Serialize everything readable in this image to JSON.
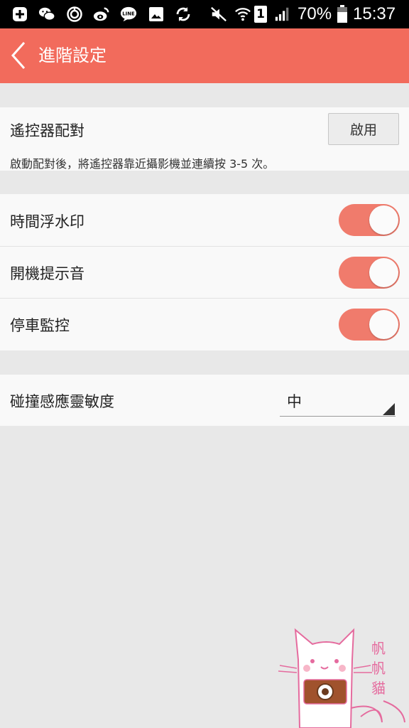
{
  "status_bar": {
    "battery_percent": "70%",
    "time": "15:37",
    "sim_label": "1",
    "icons": [
      "add-box-icon",
      "wechat-icon",
      "timer-icon",
      "weibo-icon",
      "line-icon",
      "image-icon",
      "sync-icon",
      "mute-icon",
      "wifi-icon",
      "sim-icon",
      "signal-icon",
      "battery-icon"
    ],
    "line_text": "LINE"
  },
  "app_bar": {
    "title": "進階設定",
    "background": "#f26b5c"
  },
  "remote_pairing": {
    "label": "遙控器配對",
    "button_label": "啟用",
    "hint": "啟動配對後，將遙控器靠近攝影機並連續按 3-5 次。"
  },
  "toggles": [
    {
      "label": "時間浮水印",
      "on": true
    },
    {
      "label": "開機提示音",
      "on": true
    },
    {
      "label": "停車監控",
      "on": true
    }
  ],
  "sensitivity": {
    "label": "碰撞感應靈敏度",
    "value": "中"
  },
  "watermark": {
    "text": [
      "帆",
      "帆",
      "貓"
    ]
  },
  "colors": {
    "accent": "#f26b5c",
    "toggle_on": "#f07b6c",
    "background": "#e8e8e8"
  }
}
